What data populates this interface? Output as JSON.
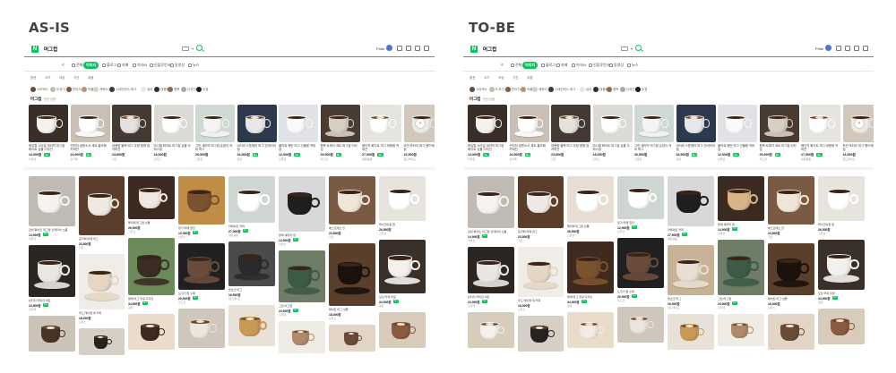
{
  "labels": {
    "as_is": "AS-IS",
    "to_be": "TO-BE"
  },
  "colors": {
    "accent": "#03c75a",
    "title": "#444444"
  },
  "search": {
    "logo": "N",
    "query": "머그컵",
    "user": "Pride"
  },
  "tabs": {
    "back": "<",
    "items": [
      {
        "label": "전체"
      },
      {
        "label": "이미지",
        "active": true
      },
      {
        "label": "블로그"
      },
      {
        "label": "카페"
      },
      {
        "label": "지식iN"
      },
      {
        "label": "인플루언서"
      },
      {
        "label": "동영상"
      },
      {
        "label": "뉴스"
      }
    ],
    "more": "…"
  },
  "filters": [
    "옵션",
    "크기",
    "색상",
    "기간",
    "유형"
  ],
  "chips": [
    {
      "label": "스타벅스"
    },
    {
      "label": "도자기"
    },
    {
      "label": "빈티지"
    },
    {
      "label": "커플"
    },
    {
      "label": "캐릭터"
    },
    {
      "label": "스테인리스 머그"
    },
    {
      "label": "유리"
    },
    {
      "label": "대용량"
    },
    {
      "label": "원목"
    },
    {
      "label": "디자인"
    },
    {
      "label": "뚜껑"
    }
  ],
  "section": {
    "title": "머그컵",
    "subtitle": "관련 상품"
  },
  "products": [
    {
      "title": "북유럽 스타일 세라믹 머그컵 화이트 심플 디자인",
      "price": "14,900원",
      "badge": "N+",
      "store": "리빙샵"
    },
    {
      "title": "빈티지 컵앤소서 세트 홈카페 커피잔",
      "price": "24,900원",
      "badge": "N+",
      "store": "홈카페"
    },
    {
      "title": "대용량 블랙 머그 무광 원형 컵 커피잔",
      "price": "23,800원",
      "badge": "",
      "store": "키친"
    },
    {
      "title": "미니멀 화이트 머그컵 심플 오피스컵",
      "price": "18,000원",
      "badge": "",
      "store": "오피스"
    },
    {
      "title": "그린 세라믹 머그컵 손잡이 커피 머그",
      "price": "26,500원",
      "badge": "",
      "store": "그릇집"
    },
    {
      "title": "네이비 스톤웨어 머그 인테리어 컵",
      "price": "34,900원",
      "badge": "N+",
      "store": "공방"
    },
    {
      "title": "플라워 패턴 머그 선물용 커피컵",
      "price": "12,900원",
      "badge": "N+",
      "store": "선물샵"
    },
    {
      "title": "원목 트레이 세트 머그컵 티타임",
      "price": "29,900원",
      "badge": "N+",
      "store": "우드샵"
    },
    {
      "title": "베이직 화이트 머그 대용량 커피잔",
      "price": "27,900원",
      "badge": "N+",
      "store": "생활용품"
    },
    {
      "title": "모던 포터리 머그 핸드메이드 컵",
      "price": "16,500원",
      "badge": "",
      "store": "핸드메이드"
    }
  ],
  "grid_captions": [
    "감성 화이트 머그컵 인테리어 소품",
    "빈티지 커피잔 세트",
    "홈카페 라떼 머그",
    "우드 테이블 위 커피",
    "플라워 머그컵 선물",
    "블랙 머그 무광 디자인",
    "창가 라떼 한잔",
    "도자기 컵 수제",
    "라떼아트 커피",
    "핫초코 머그",
    "블랙 세라믹 컵",
    "그린 머그컵",
    "에스프레소 잔",
    "화이트 머그 심플",
    "테이크아웃 컵",
    "모닝 커피 타임"
  ]
}
